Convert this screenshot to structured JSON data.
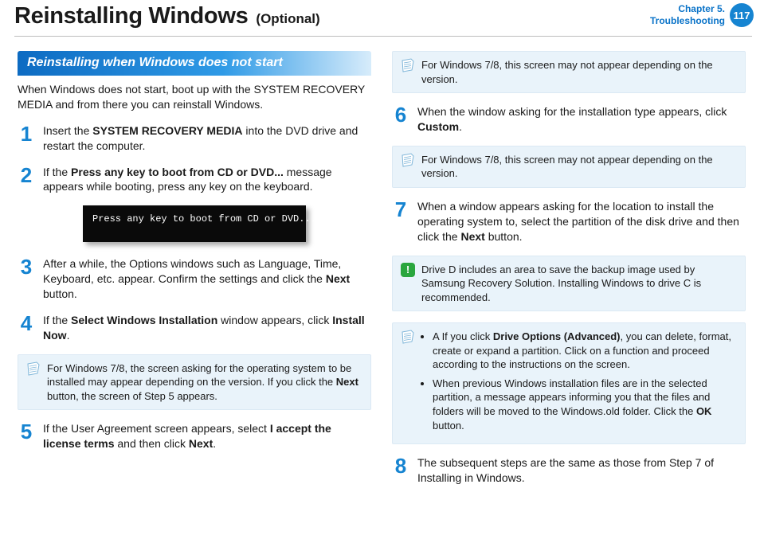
{
  "header": {
    "title": "Reinstalling Windows",
    "subtitle": "(Optional)",
    "chapter_line1": "Chapter 5.",
    "chapter_line2": "Troubleshooting",
    "page_number": "117"
  },
  "section": {
    "heading": "Reinstalling when Windows does not start",
    "intro": "When Windows does not start, boot up with the SYSTEM RECOVERY MEDIA and from there you can reinstall Windows."
  },
  "terminal": {
    "text": "Press any key to boot from CD or DVD....."
  },
  "steps": {
    "s1_pre": "Insert the ",
    "s1_bold": "SYSTEM RECOVERY MEDIA",
    "s1_post": " into the DVD drive and restart the computer.",
    "s2_pre": "If the ",
    "s2_bold": "Press any key to boot from CD or DVD...",
    "s2_post": " message appears while booting, press any key on the keyboard.",
    "s3_pre": "After a while, the Options windows such as Language, Time, Keyboard, etc. appear. Confirm the settings and click the ",
    "s3_bold": "Next",
    "s3_post": " button.",
    "s4_pre": "If the ",
    "s4_bold1": "Select Windows Installation",
    "s4_mid": " window appears, click ",
    "s4_bold2": "Install Now",
    "s4_post": ".",
    "s5_pre": "If the User Agreement screen appears, select ",
    "s5_bold1": "I accept the license terms",
    "s5_mid": " and then click ",
    "s5_bold2": "Next",
    "s5_post": ".",
    "s6_pre": "When the window asking for the installation type appears, click ",
    "s6_bold": "Custom",
    "s6_post": ".",
    "s7_pre": "When a window appears asking for the location to install the operating system to, select the partition of the disk drive and then click the ",
    "s7_bold": "Next",
    "s7_post": " button.",
    "s8": "The subsequent steps are the same as those from Step 7 of Installing in Windows."
  },
  "notes": {
    "n_after4": "For Windows 7/8, the screen asking for the operating system to be installed may appear depending on the version. If you click the ",
    "n_after4_bold": "Next",
    "n_after4_post": " button, the screen of Step 5 appears.",
    "n_win78": "For Windows 7/8, this screen may not appear depending on the version.",
    "n_driveD": "Drive D includes an area to save the backup image used by Samsung Recovery Solution. Installing Windows to drive C is recommended.",
    "n_adv_a_pre": "A If you click ",
    "n_adv_a_bold": "Drive Options (Advanced)",
    "n_adv_a_post": ", you can delete, format, create or expand a partition. Click on a function and proceed according to the instructions on the screen.",
    "n_adv_b_pre": "When previous Windows installation files are in the selected partition, a message appears informing you that the files and folders will be moved to the Windows.old folder. Click the ",
    "n_adv_b_bold": "OK",
    "n_adv_b_post": " button."
  },
  "nums": {
    "n1": "1",
    "n2": "2",
    "n3": "3",
    "n4": "4",
    "n5": "5",
    "n6": "6",
    "n7": "7",
    "n8": "8"
  }
}
